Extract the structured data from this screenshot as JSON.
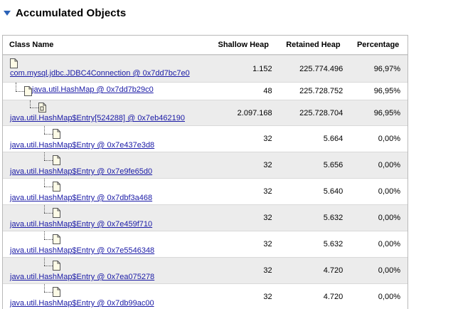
{
  "header": {
    "title": "Accumulated Objects"
  },
  "table": {
    "columns": [
      "Class Name",
      "Shallow Heap",
      "Retained Heap",
      "Percentage"
    ],
    "rows": [
      {
        "name": "com.mysql.jdbc.JDBC4Connection @ 0x7dd7bc7e0",
        "shallow": "1.152",
        "retained": "225.774.496",
        "percent": "96,97%"
      },
      {
        "name": "java.util.HashMap @ 0x7dd7b29c0",
        "shallow": "48",
        "retained": "225.728.752",
        "percent": "96,95%"
      },
      {
        "name": "java.util.HashMap$Entry[524288] @ 0x7eb462190",
        "shallow": "2.097.168",
        "retained": "225.728.704",
        "percent": "96,95%"
      },
      {
        "name": "java.util.HashMap$Entry @ 0x7e437e3d8",
        "shallow": "32",
        "retained": "5.664",
        "percent": "0,00%"
      },
      {
        "name": "java.util.HashMap$Entry @ 0x7e9fe65d0",
        "shallow": "32",
        "retained": "5.656",
        "percent": "0,00%"
      },
      {
        "name": "java.util.HashMap$Entry @ 0x7dbf3a468",
        "shallow": "32",
        "retained": "5.640",
        "percent": "0,00%"
      },
      {
        "name": "java.util.HashMap$Entry @ 0x7e459f710",
        "shallow": "32",
        "retained": "5.632",
        "percent": "0,00%"
      },
      {
        "name": "java.util.HashMap$Entry @ 0x7e5546348",
        "shallow": "32",
        "retained": "5.632",
        "percent": "0,00%"
      },
      {
        "name": "java.util.HashMap$Entry @ 0x7ea075278",
        "shallow": "32",
        "retained": "4.720",
        "percent": "0,00%"
      },
      {
        "name": "java.util.HashMap$Entry @ 0x7db99ac00",
        "shallow": "32",
        "retained": "4.720",
        "percent": "0,00%"
      }
    ]
  }
}
